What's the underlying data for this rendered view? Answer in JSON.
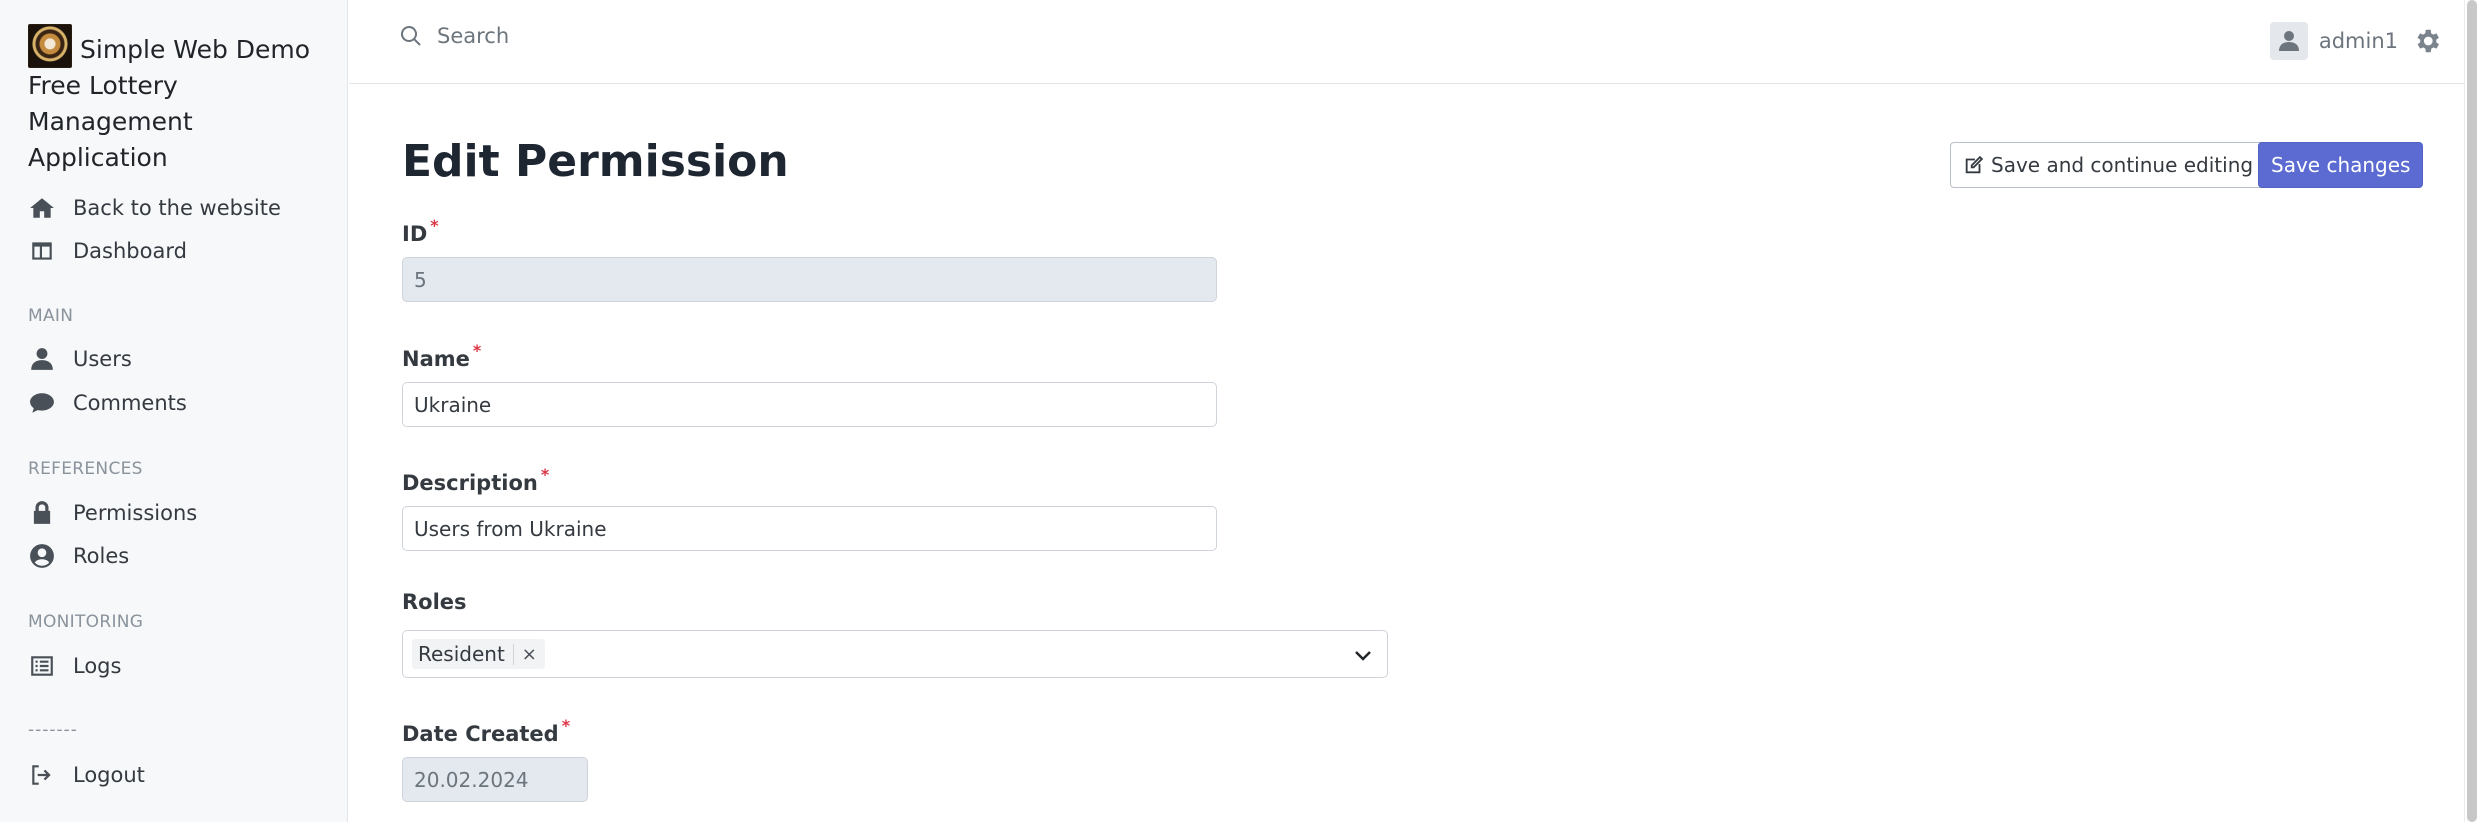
{
  "app": {
    "title": "Simple Web Demo Free Lottery Management Application"
  },
  "sidebar": {
    "items_top": [
      {
        "label": "Back to the website",
        "icon": "home-icon"
      },
      {
        "label": "Dashboard",
        "icon": "dashboard-icon"
      }
    ],
    "sections": [
      {
        "title": "MAIN",
        "items": [
          {
            "label": "Users",
            "icon": "user-icon"
          },
          {
            "label": "Comments",
            "icon": "comment-icon"
          }
        ]
      },
      {
        "title": "REFERENCES",
        "items": [
          {
            "label": "Permissions",
            "icon": "lock-icon"
          },
          {
            "label": "Roles",
            "icon": "user-circle-icon"
          }
        ]
      },
      {
        "title": "MONITORING",
        "items": [
          {
            "label": "Logs",
            "icon": "list-icon"
          }
        ]
      }
    ],
    "separator": "-------",
    "logout": {
      "label": "Logout",
      "icon": "logout-icon"
    }
  },
  "topbar": {
    "search_placeholder": "Search",
    "username": "admin1"
  },
  "page": {
    "title": "Edit Permission",
    "save_continue_label": "Save and continue editing",
    "save_label": "Save changes"
  },
  "form": {
    "id": {
      "label": "ID",
      "required_mark": "*",
      "value": "5"
    },
    "name": {
      "label": "Name",
      "required_mark": "*",
      "value": "Ukraine"
    },
    "description": {
      "label": "Description",
      "required_mark": "*",
      "value": "Users from Ukraine"
    },
    "roles": {
      "label": "Roles",
      "selected": [
        "Resident"
      ],
      "remove_glyph": "×"
    },
    "date_created": {
      "label": "Date Created",
      "required_mark": "*",
      "value": "20.02.2024"
    }
  },
  "colors": {
    "primary": "#5b6bd1",
    "required": "#dc3545",
    "sidebar_bg": "#f7f8fa",
    "disabled_bg": "#e4e8ef"
  }
}
